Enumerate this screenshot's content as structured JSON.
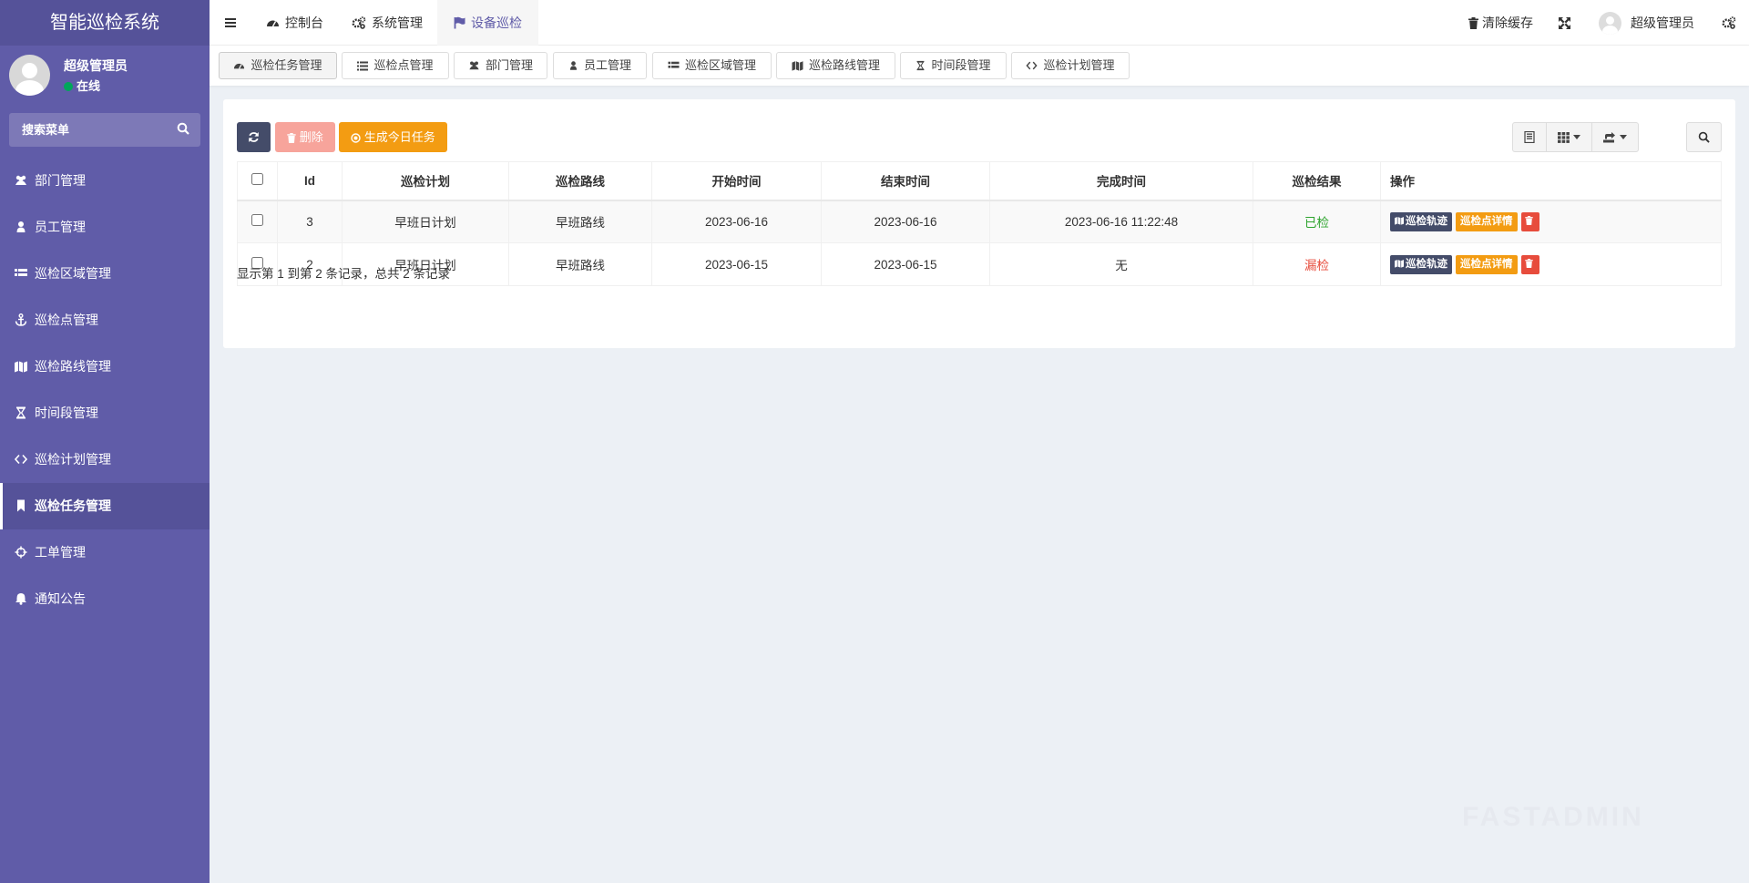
{
  "app": {
    "logo": "智能巡检系统",
    "user_name": "超级管理员",
    "user_status": "在线"
  },
  "sidebar": {
    "search_placeholder": "搜索菜单",
    "items": [
      {
        "label": "部门管理",
        "icon": "users-icon"
      },
      {
        "label": "员工管理",
        "icon": "user-icon"
      },
      {
        "label": "巡检区域管理",
        "icon": "th-list-icon"
      },
      {
        "label": "巡检点管理",
        "icon": "anchor-icon"
      },
      {
        "label": "巡检路线管理",
        "icon": "map-icon"
      },
      {
        "label": "时间段管理",
        "icon": "hourglass-icon"
      },
      {
        "label": "巡检计划管理",
        "icon": "code-icon"
      },
      {
        "label": "巡检任务管理",
        "icon": "bookmark-icon",
        "active": true
      },
      {
        "label": "工单管理",
        "icon": "crosshairs-icon"
      },
      {
        "label": "通知公告",
        "icon": "bell-icon"
      }
    ]
  },
  "topbar": {
    "dashboard": "控制台",
    "system": "系统管理",
    "device_patrol": "设备巡检",
    "clear_cache": "清除缓存",
    "admin_name": "超级管理员"
  },
  "tabs": [
    {
      "label": "巡检任务管理",
      "icon": "dashboard-icon",
      "active": true
    },
    {
      "label": "巡检点管理",
      "icon": "list-icon"
    },
    {
      "label": "部门管理",
      "icon": "users-icon"
    },
    {
      "label": "员工管理",
      "icon": "user-icon"
    },
    {
      "label": "巡检区域管理",
      "icon": "th-list-icon"
    },
    {
      "label": "巡检路线管理",
      "icon": "map-icon"
    },
    {
      "label": "时间段管理",
      "icon": "hourglass-icon"
    },
    {
      "label": "巡检计划管理",
      "icon": "code-icon"
    }
  ],
  "toolbar": {
    "delete_label": "删除",
    "generate_label": "生成今日任务"
  },
  "table": {
    "headers": [
      "Id",
      "巡检计划",
      "巡检路线",
      "开始时间",
      "结束时间",
      "完成时间",
      "巡检结果",
      "操作"
    ],
    "rows": [
      {
        "id": "3",
        "plan": "早班日计划",
        "route": "早班路线",
        "start": "2023-06-16",
        "end": "2023-06-16",
        "finish": "2023-06-16 11:22:48",
        "result": "已检",
        "result_status": "ok"
      },
      {
        "id": "2",
        "plan": "早班日计划",
        "route": "早班路线",
        "start": "2023-06-15",
        "end": "2023-06-15",
        "finish": "无",
        "result": "漏检",
        "result_status": "missed"
      }
    ],
    "action_track": "巡检轨迹",
    "action_detail": "巡检点详情"
  },
  "pager": {
    "info": "显示第 1 到第 2 条记录，总共 2 条记录"
  },
  "watermark": "FASTADMIN",
  "colors": {
    "sidebar_bg": "#605ca8",
    "primary_dark": "#444c69",
    "warning": "#f39c12",
    "danger": "#e74c3c",
    "success": "#2ea42e"
  }
}
